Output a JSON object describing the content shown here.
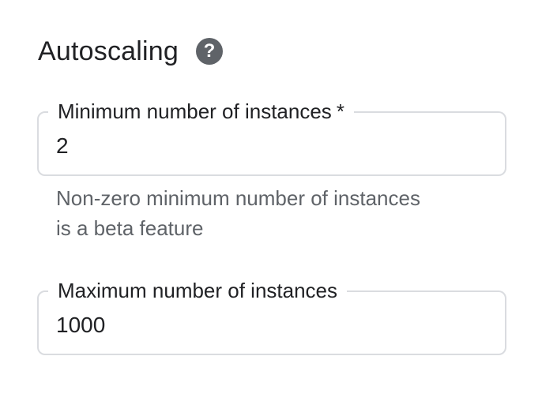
{
  "section": {
    "title": "Autoscaling",
    "help_icon": "question-mark-circle-icon",
    "help_glyph": "?"
  },
  "min_instances": {
    "label": "Minimum number of instances",
    "required_marker": "*",
    "value": "2",
    "hint_line1": "Non-zero minimum number of instances",
    "hint_line2": "is a beta feature"
  },
  "max_instances": {
    "label": "Maximum number of instances",
    "value": "1000"
  },
  "colors": {
    "text": "#202124",
    "secondary_text": "#5f6368",
    "border": "#dadce0",
    "icon": "#5f6368"
  }
}
